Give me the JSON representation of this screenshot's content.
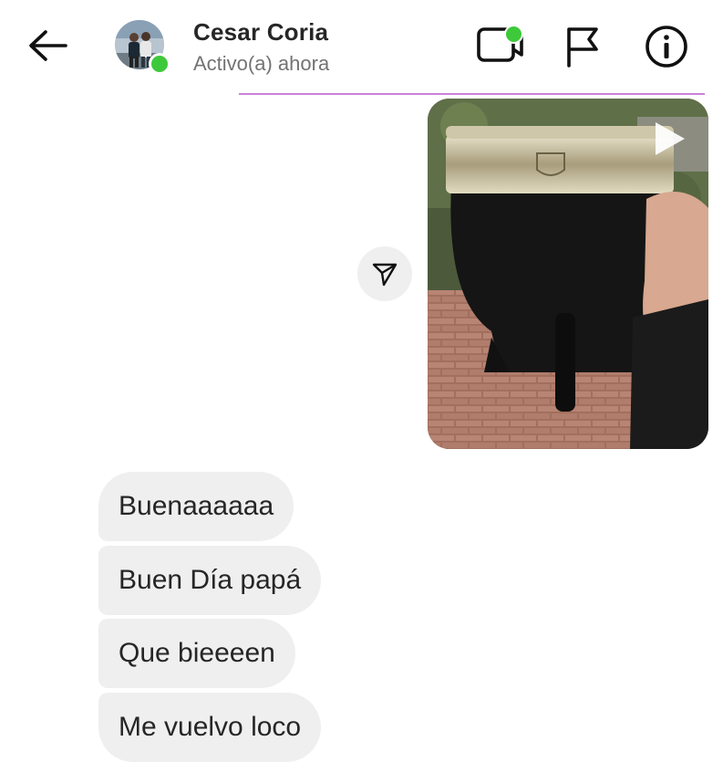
{
  "header": {
    "back_icon": "arrow-left-icon",
    "contact_name": "Cesar Coria",
    "status": "Activo(a) ahora",
    "online": true,
    "icons": [
      "video-call-icon",
      "flag-icon",
      "info-icon"
    ]
  },
  "colors": {
    "online_green": "#3ec93a",
    "divider": "#c983d8",
    "bubble_bg": "#efefef",
    "text": "#262626",
    "muted": "#737373"
  },
  "thread": {
    "media_message": {
      "type": "video",
      "play_icon": "play-icon",
      "share_icon": "paper-plane-icon"
    },
    "messages": [
      {
        "text": "Buenaaaaaa"
      },
      {
        "text": "Buen Día papá"
      },
      {
        "text": "Que bieeeen"
      },
      {
        "text": "Me vuelvo loco"
      }
    ]
  }
}
